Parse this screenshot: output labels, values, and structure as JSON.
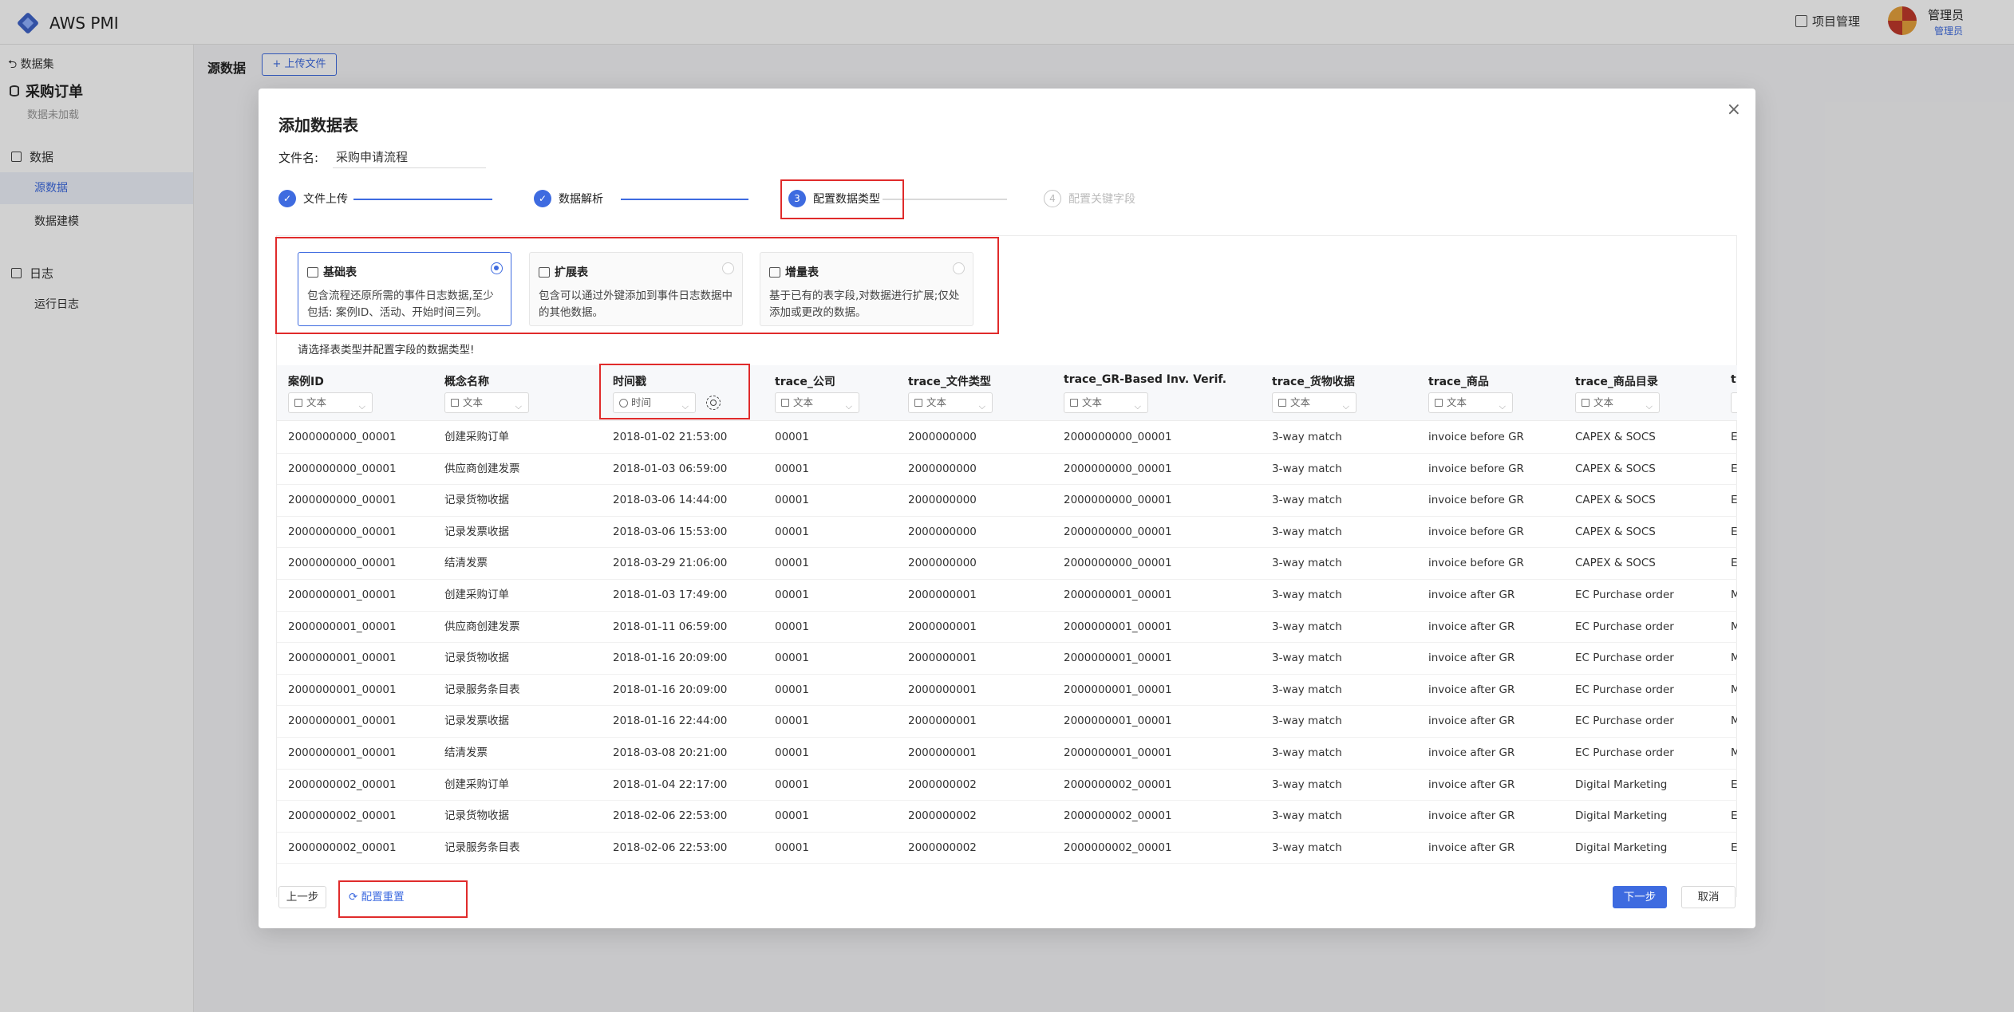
{
  "app": {
    "brand": "AWS PMI",
    "project_mgmt": "项目管理",
    "user_name": "管理员",
    "user_role": "管理员"
  },
  "sidebar": {
    "back": "数据集",
    "title": "采购订单",
    "subtitle": "数据未加载",
    "section_data": "数据",
    "item_source": "源数据",
    "item_model": "数据建模",
    "section_log": "日志",
    "item_runlog": "运行日志"
  },
  "page": {
    "breadcrumb": "源数据",
    "upload_btn": "+ 上传文件"
  },
  "modal": {
    "title": "添加数据表",
    "close": "×",
    "file_label": "文件名:",
    "file_value": "采购申请流程",
    "steps": [
      {
        "num": "✓",
        "label": "文件上传"
      },
      {
        "num": "✓",
        "label": "数据解析"
      },
      {
        "num": "3",
        "label": "配置数据类型"
      },
      {
        "num": "4",
        "label": "配置关键字段"
      }
    ],
    "table_types": [
      {
        "name": "基础表",
        "desc": "包含流程还原所需的事件日志数据,至少包括: 案例ID、活动、开始时间三列。",
        "selected": true
      },
      {
        "name": "扩展表",
        "desc": "包含可以通过外键添加到事件日志数据中的其他数据。",
        "selected": false
      },
      {
        "name": "增量表",
        "desc": "基于已有的表字段,对数据进行扩展;仅处添加或更改的数据。",
        "selected": false
      }
    ],
    "hint": "请选择表类型并配置字段的数据类型!",
    "columns": [
      {
        "name": "案例ID",
        "type": "文本"
      },
      {
        "name": "概念名称",
        "type": "文本"
      },
      {
        "name": "时间戳",
        "type": "时间"
      },
      {
        "name": "trace_公司",
        "type": "文本"
      },
      {
        "name": "trace_文件类型",
        "type": "文本"
      },
      {
        "name": "trace_GR-Based Inv. Verif.",
        "type": "文本"
      },
      {
        "name": "trace_货物收据",
        "type": "文本"
      },
      {
        "name": "trace_商品",
        "type": "文本"
      },
      {
        "name": "trace_商品目录",
        "type": "文本"
      },
      {
        "name": "t",
        "type": "文本"
      }
    ],
    "rows": [
      [
        "2000000000_00001",
        "创建采购订单",
        "2018-01-02 21:53:00",
        "00001",
        "2000000000",
        "2000000000_00001",
        "3-way match",
        "invoice before GR",
        "CAPEX & SOCS",
        "E"
      ],
      [
        "2000000000_00001",
        "供应商创建发票",
        "2018-01-03 06:59:00",
        "00001",
        "2000000000",
        "2000000000_00001",
        "3-way match",
        "invoice before GR",
        "CAPEX & SOCS",
        "E"
      ],
      [
        "2000000000_00001",
        "记录货物收据",
        "2018-03-06 14:44:00",
        "00001",
        "2000000000",
        "2000000000_00001",
        "3-way match",
        "invoice before GR",
        "CAPEX & SOCS",
        "E"
      ],
      [
        "2000000000_00001",
        "记录发票收据",
        "2018-03-06 15:53:00",
        "00001",
        "2000000000",
        "2000000000_00001",
        "3-way match",
        "invoice before GR",
        "CAPEX & SOCS",
        "E"
      ],
      [
        "2000000000_00001",
        "结清发票",
        "2018-03-29 21:06:00",
        "00001",
        "2000000000",
        "2000000000_00001",
        "3-way match",
        "invoice before GR",
        "CAPEX & SOCS",
        "E"
      ],
      [
        "2000000001_00001",
        "创建采购订单",
        "2018-01-03 17:49:00",
        "00001",
        "2000000001",
        "2000000001_00001",
        "3-way match",
        "invoice after GR",
        "EC Purchase order",
        "M"
      ],
      [
        "2000000001_00001",
        "供应商创建发票",
        "2018-01-11 06:59:00",
        "00001",
        "2000000001",
        "2000000001_00001",
        "3-way match",
        "invoice after GR",
        "EC Purchase order",
        "M"
      ],
      [
        "2000000001_00001",
        "记录货物收据",
        "2018-01-16 20:09:00",
        "00001",
        "2000000001",
        "2000000001_00001",
        "3-way match",
        "invoice after GR",
        "EC Purchase order",
        "M"
      ],
      [
        "2000000001_00001",
        "记录服务条目表",
        "2018-01-16 20:09:00",
        "00001",
        "2000000001",
        "2000000001_00001",
        "3-way match",
        "invoice after GR",
        "EC Purchase order",
        "M"
      ],
      [
        "2000000001_00001",
        "记录发票收据",
        "2018-01-16 22:44:00",
        "00001",
        "2000000001",
        "2000000001_00001",
        "3-way match",
        "invoice after GR",
        "EC Purchase order",
        "M"
      ],
      [
        "2000000001_00001",
        "结清发票",
        "2018-03-08 20:21:00",
        "00001",
        "2000000001",
        "2000000001_00001",
        "3-way match",
        "invoice after GR",
        "EC Purchase order",
        "M"
      ],
      [
        "2000000002_00001",
        "创建采购订单",
        "2018-01-04 22:17:00",
        "00001",
        "2000000002",
        "2000000002_00001",
        "3-way match",
        "invoice after GR",
        "Digital Marketing",
        "E"
      ],
      [
        "2000000002_00001",
        "记录货物收据",
        "2018-02-06 22:53:00",
        "00001",
        "2000000002",
        "2000000002_00001",
        "3-way match",
        "invoice after GR",
        "Digital Marketing",
        "E"
      ],
      [
        "2000000002_00001",
        "记录服务条目表",
        "2018-02-06 22:53:00",
        "00001",
        "2000000002",
        "2000000002_00001",
        "3-way match",
        "invoice after GR",
        "Digital Marketing",
        "E"
      ]
    ],
    "btn_prev": "上一步",
    "btn_reset": "配置重置",
    "btn_next": "下一步",
    "btn_cancel": "取消"
  },
  "colors": {
    "accent": "#3e6be0",
    "highlight": "#e02b2b"
  }
}
